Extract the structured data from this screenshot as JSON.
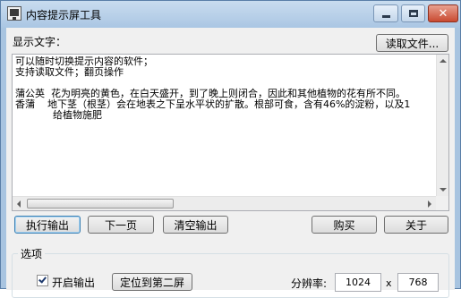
{
  "window": {
    "title": "内容提示屏工具",
    "close_glyph": "✕"
  },
  "display": {
    "label": "显示文字：",
    "read_file_button": "读取文件...",
    "text": "可以随时切换提示内容的软件；\n支持读取文件；翻页操作\n\n蒲公英  花为明亮的黄色，在白天盛开，到了晚上则闭合，因此和其他植物的花有所不同。\n香蒲    地下茎（根茎）会在地表之下呈水平状的扩散。根部可食，含有46%的淀粉，以及1\n            给植物施肥"
  },
  "buttons": {
    "execute": "执行输出",
    "next_page": "下一页",
    "clear": "清空输出",
    "buy": "购买",
    "about": "关于"
  },
  "options": {
    "group_title": "选项",
    "enable_output_label": "开启输出",
    "enable_output_checked": true,
    "locate_second_screen": "定位到第二屏",
    "resolution_label": "分辨率:",
    "width": "1024",
    "x_label": "x",
    "height": "768"
  },
  "icons": {
    "app": "monitor-icon",
    "minimize": "minimize-icon",
    "maximize": "maximize-icon",
    "close": "close-icon"
  }
}
